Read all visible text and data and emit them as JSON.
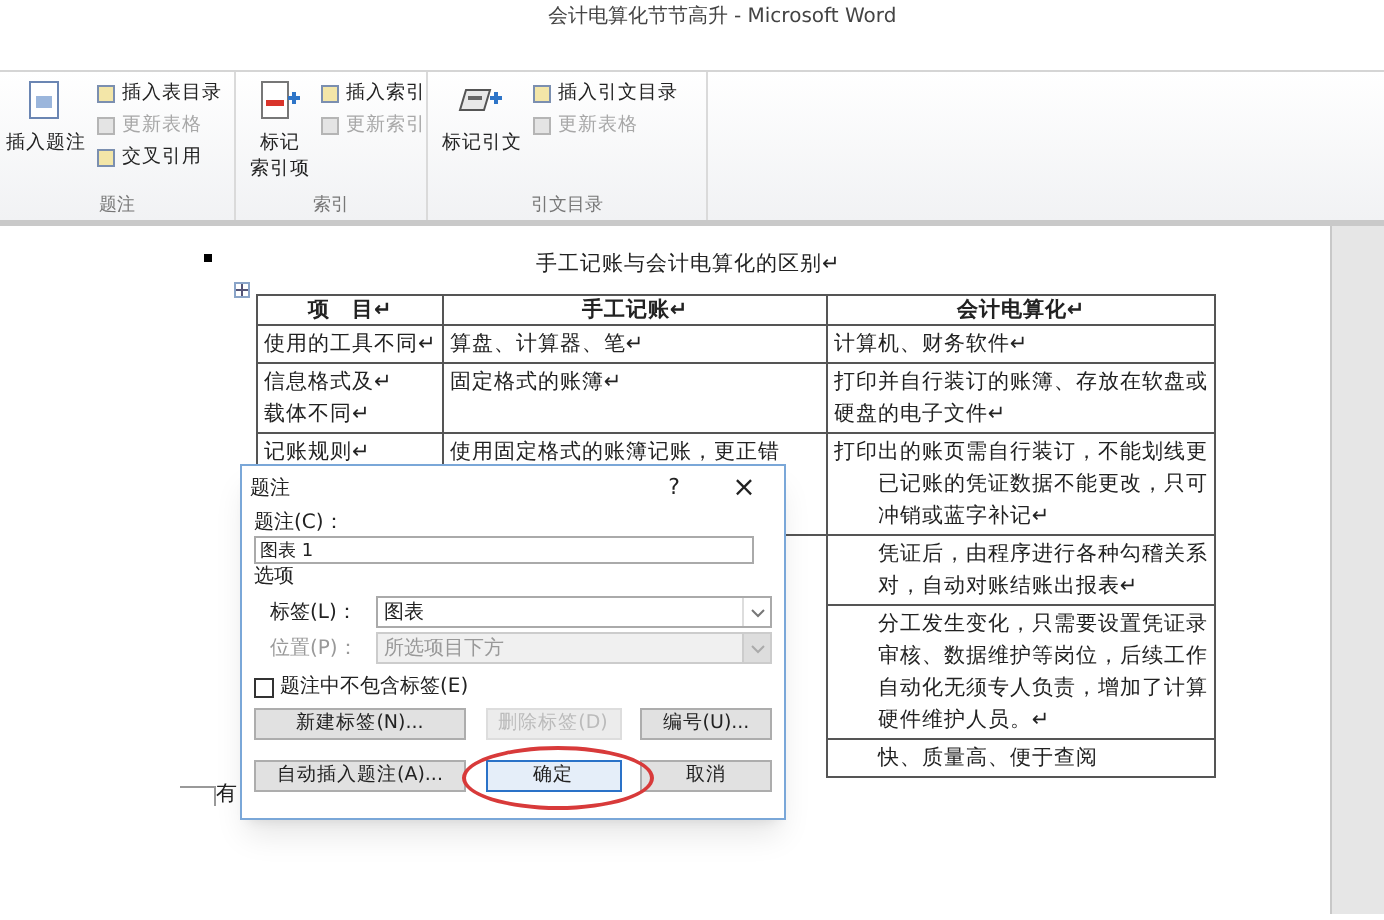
{
  "window": {
    "title": "会计电算化节节高升 - Microsoft Word"
  },
  "ribbon": {
    "groups": [
      {
        "label": "题注",
        "big_button": {
          "lines": [
            "插入题注"
          ]
        },
        "small_buttons": [
          {
            "label": "插入表目录",
            "disabled": false
          },
          {
            "label": "更新表格",
            "disabled": true
          },
          {
            "label": "交叉引用",
            "disabled": false
          }
        ]
      },
      {
        "label": "索引",
        "big_button": {
          "lines": [
            "标记",
            "索引项"
          ]
        },
        "small_buttons": [
          {
            "label": "插入索引",
            "disabled": false
          },
          {
            "label": "更新索引",
            "disabled": true
          }
        ]
      },
      {
        "label": "引文目录",
        "big_button": {
          "lines": [
            "标记引文"
          ]
        },
        "small_buttons": [
          {
            "label": "插入引文目录",
            "disabled": false
          },
          {
            "label": "更新表格",
            "disabled": true
          }
        ]
      }
    ]
  },
  "document": {
    "table_title": "手工记账与会计电算化的区别↵",
    "table": {
      "columns": [
        "项　目↵",
        "手工记账↵",
        "会计电算化↵"
      ],
      "rows": [
        {
          "cells": [
            [
              "使用的工具不同↵"
            ],
            [
              "算盘、计算器、笔↵"
            ],
            [
              "计算机、财务软件↵"
            ]
          ]
        },
        {
          "cells": [
            [
              "信息格式及↵",
              "载体不同↵"
            ],
            [
              "固定格式的账簿↵"
            ],
            [
              "打印并自行装订的账簿、存放在软盘或",
              "硬盘的电子文件↵"
            ]
          ]
        },
        {
          "cells": [
            [
              "记账规则↵"
            ],
            [
              "使用固定格式的账簿记账，更正错"
            ],
            [
              "打印出的账页需自行装订，不能划线更",
              "已记账的凭证数据不能更改，只可",
              "冲销或蓝字补记↵"
            ]
          ]
        },
        {
          "cells": [
            [],
            [],
            [
              "凭证后，由程序进行各种勾稽关系",
              "对，自动对账结账出报表↵"
            ]
          ]
        },
        {
          "cells": [
            [],
            [],
            [
              "分工发生变化，只需要设置凭证录",
              "审核、数据维护等岗位，后续工作",
              "自动化无须专人负责，增加了计算",
              "硬件维护人员。↵"
            ]
          ]
        },
        {
          "cells": [
            [],
            [],
            [
              "快、质量高、便于查阅"
            ]
          ]
        }
      ]
    },
    "paragraph": "有"
  },
  "dialog": {
    "title": "题注",
    "help": "?",
    "close": "×",
    "caption_label": "题注(C)：",
    "caption_value": "图表 1",
    "options_label": "选项",
    "label_field": {
      "label": "标签(L)：",
      "value": "图表",
      "disabled": false
    },
    "position_field": {
      "label": "位置(P)：",
      "value": "所选项目下方",
      "disabled": true
    },
    "exclude_label": {
      "label": "题注中不包含标签(E)",
      "checked": false
    },
    "buttons": [
      {
        "label": "新建标签(N)...",
        "disabled": false,
        "default": false
      },
      {
        "label": "删除标签(D)",
        "disabled": true,
        "default": false
      },
      {
        "label": "编号(U)...",
        "disabled": false,
        "default": false
      }
    ],
    "bottom_buttons": [
      {
        "label": "自动插入题注(A)...",
        "disabled": false,
        "default": false
      },
      {
        "label": "确定",
        "disabled": false,
        "default": true
      },
      {
        "label": "取消",
        "disabled": false,
        "default": false
      }
    ]
  }
}
